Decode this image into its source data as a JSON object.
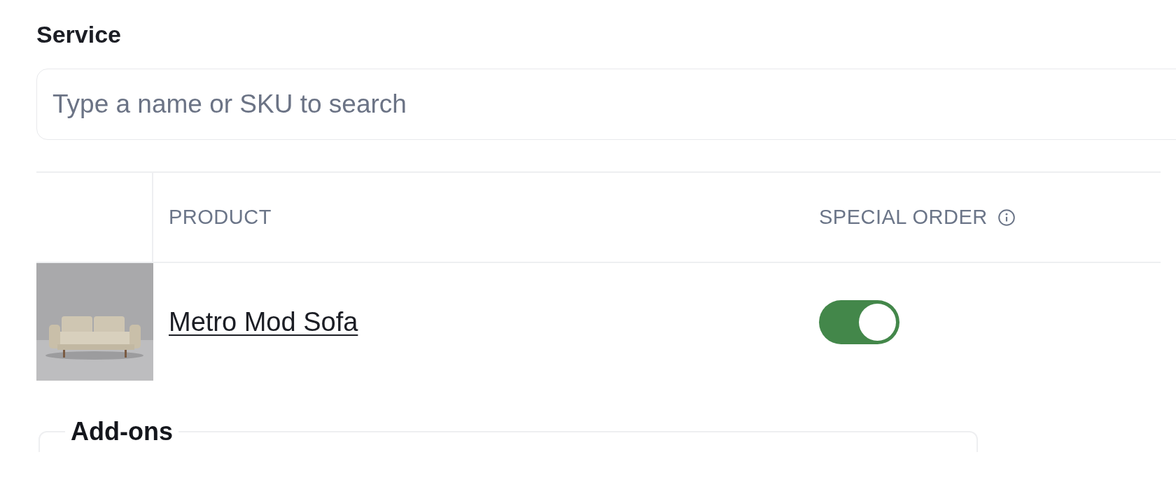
{
  "section_label": "Service",
  "search": {
    "placeholder": "Type a name or SKU to search"
  },
  "table": {
    "columns": [
      {
        "label": "PRODUCT",
        "info": false
      },
      {
        "label": "SPECIAL ORDER",
        "info": true
      }
    ],
    "rows": [
      {
        "product": "Metro Mod Sofa",
        "special_order": true
      }
    ]
  },
  "addons": {
    "legend": "Add-ons"
  }
}
